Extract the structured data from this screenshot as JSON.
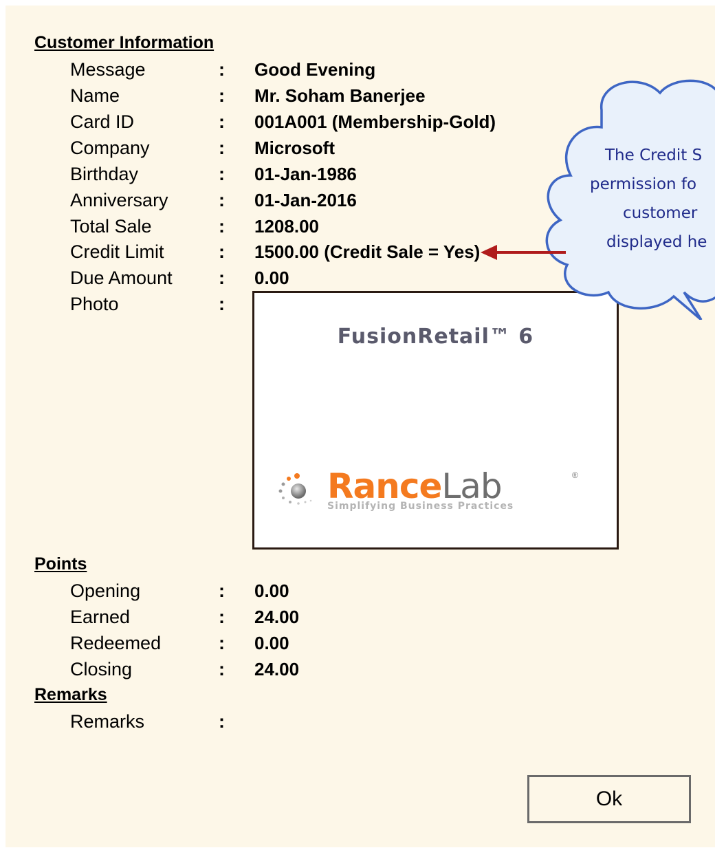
{
  "customer_section": {
    "title": "Customer Information",
    "fields": [
      {
        "label": "Message",
        "colon": ":",
        "value": "Good Evening"
      },
      {
        "label": "Name",
        "colon": ":",
        "value": "Mr. Soham Banerjee"
      },
      {
        "label": "Card ID",
        "colon": ":",
        "value": "001A001 (Membership-Gold)"
      },
      {
        "label": "Company",
        "colon": ":",
        "value": "Microsoft"
      },
      {
        "label": "Birthday",
        "colon": ":",
        "value": "01-Jan-1986"
      },
      {
        "label": "Anniversary",
        "colon": ":",
        "value": "01-Jan-2016"
      },
      {
        "label": "Total Sale",
        "colon": ":",
        "value": "1208.00"
      },
      {
        "label": "Credit Limit",
        "colon": ":",
        "value": "1500.00 (Credit Sale = Yes)"
      },
      {
        "label": "Due Amount",
        "colon": ":",
        "value": "0.00"
      },
      {
        "label": "Photo",
        "colon": ":",
        "value": ""
      }
    ]
  },
  "photo": {
    "title": "FusionRetail™ 6",
    "logo_word_1": "Rance",
    "logo_word_2": "Lab",
    "logo_reg": "®",
    "tagline": "Simplifying Business Practices"
  },
  "points_section": {
    "title": "Points",
    "fields": [
      {
        "label": "Opening",
        "colon": ":",
        "value": "0.00"
      },
      {
        "label": "Earned",
        "colon": ":",
        "value": "24.00"
      },
      {
        "label": "Redeemed",
        "colon": ":",
        "value": "0.00"
      },
      {
        "label": "Closing",
        "colon": ":",
        "value": "24.00"
      }
    ]
  },
  "remarks_section": {
    "title": "Remarks",
    "fields": [
      {
        "label": "Remarks",
        "colon": ":",
        "value": ""
      }
    ]
  },
  "callout": {
    "lines": [
      "The Credit S",
      "permission fo",
      "customer",
      "displayed he"
    ]
  },
  "ok_button": {
    "label": "Ok"
  },
  "colors": {
    "panel_bg": "#fdf7e8",
    "callout_text": "#1f2a8a",
    "arrow": "#b01c1c",
    "logo_orange": "#f47a1f"
  }
}
